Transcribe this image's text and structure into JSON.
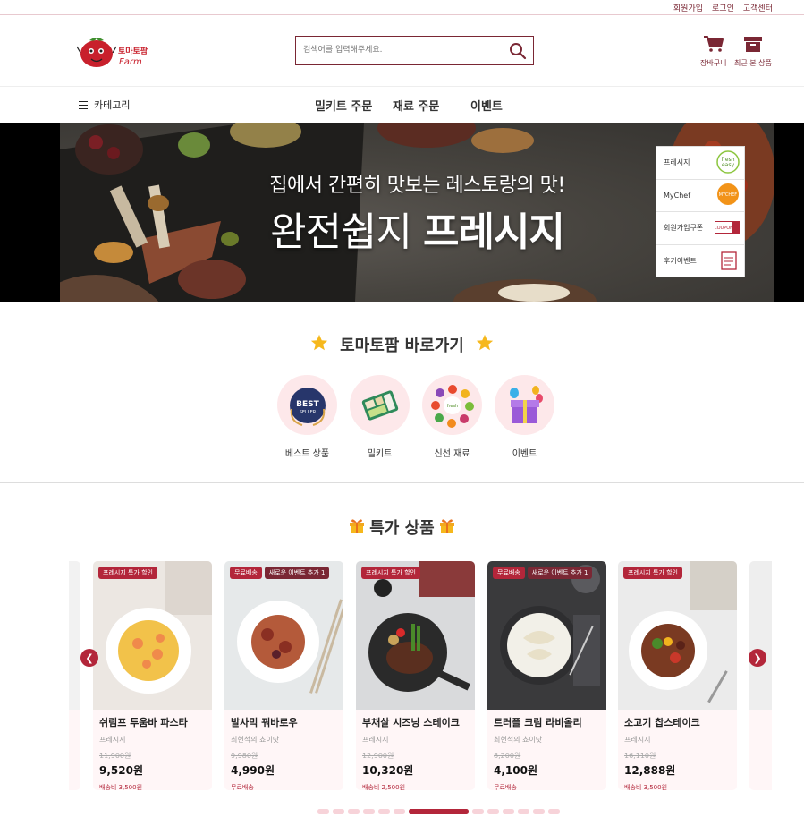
{
  "util": {
    "links": [
      "회원가입",
      "로그인",
      "고객센터"
    ]
  },
  "header": {
    "search_placeholder": "검색어를 입력해주세요.",
    "cart_label": "장바구니",
    "recent_label": "최근 본 상품"
  },
  "nav": {
    "category_label": "카테고리",
    "links": [
      "밀키트 주문",
      "재료 주문",
      "이벤트"
    ]
  },
  "banner": {
    "subtitle": "집에서 간편히 맛보는 레스토랑의 맛!",
    "title_light": "완전쉽지 ",
    "title_bold": "프레시지",
    "quick_menu": [
      "프레시지",
      "MyChef",
      "회원가입쿠폰",
      "후기이벤트"
    ]
  },
  "shortcuts": {
    "title": "토마토팜 바로가기",
    "items": [
      "베스트 상품",
      "밀키트",
      "신선 재료",
      "이벤트"
    ]
  },
  "special": {
    "title": "특가 상품",
    "products": [
      {
        "badges": [
          "프레시지 특가 할인"
        ],
        "name": "쉬림프 투움바 파스타",
        "brand": "프레시지",
        "original_price": "11,900원",
        "price": "9,520원",
        "shipping": "배송비 3,500원"
      },
      {
        "badges": [
          "무료배송",
          "새로운 이벤트 추가 1"
        ],
        "name": "발사믹 꿔바로우",
        "brand": "최현석의 쵸이닷",
        "original_price": "9,980원",
        "price": "4,990원",
        "shipping": "무료배송"
      },
      {
        "badges": [
          "프레시지 특가 할인"
        ],
        "name": "부채살 시즈닝 스테이크",
        "brand": "프레시지",
        "original_price": "12,900원",
        "price": "10,320원",
        "shipping": "배송비 2,500원"
      },
      {
        "badges": [
          "무료배송",
          "새로운 이벤트 추가 1"
        ],
        "name": "트러플 크림 라비올리",
        "brand": "최현석의 쵸이닷",
        "original_price": "8,200원",
        "price": "4,100원",
        "shipping": "무료배송"
      },
      {
        "badges": [
          "프레시지 특가 할인"
        ],
        "name": "소고기 찹스테이크",
        "brand": "프레시지",
        "original_price": "16,110원",
        "price": "12,888원",
        "shipping": "배송비 3,500원"
      }
    ],
    "dots_count": 13,
    "active_dot": 6
  },
  "colors": {
    "brand": "#7a2734",
    "accent": "#b3263a",
    "pink": "#fde8ea"
  }
}
